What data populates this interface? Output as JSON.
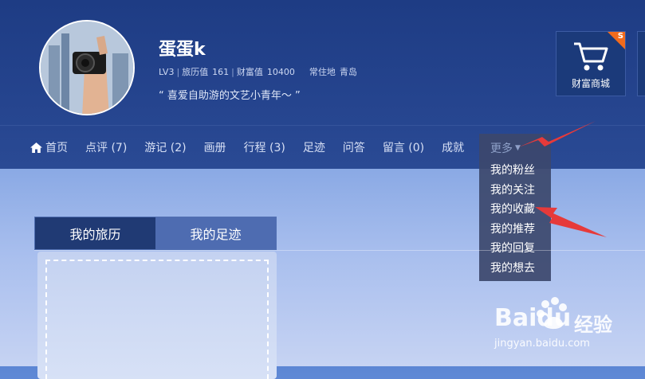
{
  "profile": {
    "username": "蛋蛋k",
    "level": "LV3",
    "travel_label": "旅历值",
    "travel_value": "161",
    "wealth_label": "财富值",
    "wealth_value": "10400",
    "residence_label": "常住地",
    "residence_value": "青岛",
    "motto": "“ 喜爱自助游的文艺小青年～ ”"
  },
  "shop": {
    "label": "财富商城",
    "badge": "S",
    "icon": "cart-icon"
  },
  "nav": {
    "home_icon": "home-icon",
    "items": [
      "首页",
      "点评 (7)",
      "游记 (2)",
      "画册",
      "行程 (3)",
      "足迹",
      "问答",
      "留言 (0)",
      "成就",
      "更多"
    ],
    "more_caret_icon": "caret-down-icon"
  },
  "dropdown": {
    "items": [
      "我的粉丝",
      "我的关注",
      "我的收藏",
      "我的推荐",
      "我的回复",
      "我的想去"
    ]
  },
  "tabs": [
    "我的旅历",
    "我的足迹"
  ],
  "watermark": {
    "brand_left": "Bai",
    "brand_right": "du",
    "suffix": "经验",
    "url": "jingyan.baidu.com"
  },
  "colors": {
    "arrow": "#e63a3a",
    "header": "#25448e",
    "badge": "#f26b1d"
  }
}
